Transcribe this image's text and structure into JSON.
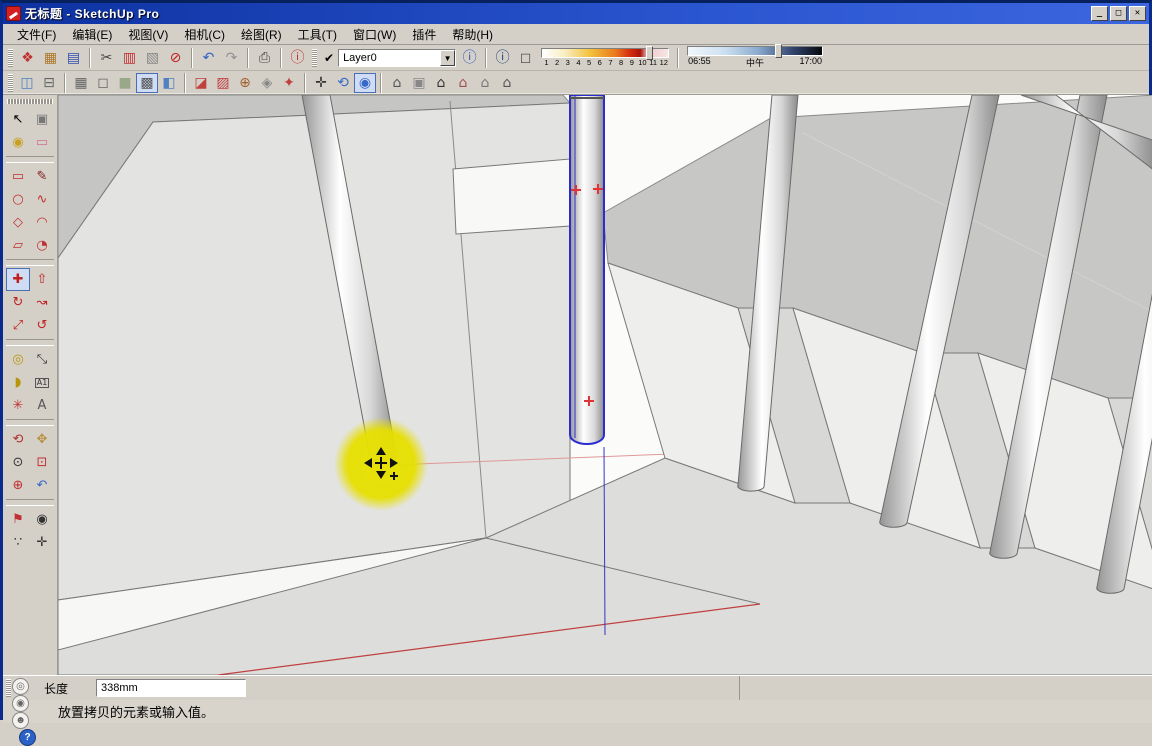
{
  "window": {
    "title": "无标题 - SketchUp Pro",
    "minimize": "_",
    "maximize": "□",
    "close": "✕"
  },
  "menu": {
    "items": [
      "文件(F)",
      "编辑(E)",
      "视图(V)",
      "相机(C)",
      "绘图(R)",
      "工具(T)",
      "窗口(W)",
      "插件",
      "帮助(H)"
    ]
  },
  "toolbar_main": {
    "file_buttons": [
      {
        "name": "new-button",
        "glyph": "❖",
        "color": "#c03030"
      },
      {
        "name": "open-button",
        "glyph": "▦",
        "color": "#b07828"
      },
      {
        "name": "save-button",
        "glyph": "▤",
        "color": "#3050b0"
      }
    ],
    "edit_buttons": [
      {
        "name": "cut-button",
        "glyph": "✂",
        "color": "#444444"
      },
      {
        "name": "copy-button",
        "glyph": "▥",
        "color": "#c03030"
      },
      {
        "name": "paste-button",
        "glyph": "▧",
        "color": "#888888"
      },
      {
        "name": "erase-button",
        "glyph": "⊘",
        "color": "#c02020"
      }
    ],
    "undo_buttons": [
      {
        "name": "undo-button",
        "glyph": "↶",
        "color": "#3060c0"
      },
      {
        "name": "redo-button",
        "glyph": "↷",
        "color": "#909090"
      }
    ],
    "print_buttons": [
      {
        "name": "print-button",
        "glyph": "⎙",
        "color": "#444444"
      }
    ],
    "info_buttons": [
      {
        "name": "model-info-button",
        "glyph": "ⓘ",
        "color": "#c03030"
      }
    ],
    "layer": {
      "check": "✔",
      "selected": "Layer0",
      "dropdown": "▼"
    },
    "layer_buttons": [
      {
        "name": "layer-manager-button",
        "glyph": "ⓘ",
        "color": "#2858b8"
      }
    ],
    "shadow_buttons": [
      {
        "name": "shadow-settings-button",
        "glyph": "ⓘ",
        "color": "#204080"
      },
      {
        "name": "shadow-toggle-button",
        "glyph": "◻",
        "color": "#555555"
      }
    ],
    "month_slider": {
      "ticks": [
        "1",
        "2",
        "3",
        "4",
        "5",
        "6",
        "7",
        "8",
        "9",
        "10",
        "11",
        "12"
      ],
      "value_percent": 84
    },
    "time_slider": {
      "start": "06:55",
      "mid": "中午",
      "end": "17:00",
      "value_percent": 67
    }
  },
  "toolbar_view": {
    "style_buttons_a": [
      {
        "name": "xray-mode-button",
        "glyph": "◫",
        "color": "#5080c0"
      },
      {
        "name": "back-edges-button",
        "glyph": "⊟",
        "color": "#666666"
      }
    ],
    "style_buttons_b": [
      {
        "name": "wireframe-button",
        "glyph": "▦",
        "color": "#666666"
      },
      {
        "name": "hidden-line-button",
        "glyph": "◻",
        "color": "#666666"
      },
      {
        "name": "shaded-button",
        "glyph": "■",
        "color": "#9aa88a"
      },
      {
        "name": "shaded-textures-button",
        "glyph": "▩",
        "color": "#555555",
        "selected": true
      },
      {
        "name": "monochrome-button",
        "glyph": "◧",
        "color": "#5080c0"
      }
    ],
    "section_buttons": [
      {
        "name": "section-plane-button",
        "glyph": "◪",
        "color": "#c04040"
      },
      {
        "name": "section-display-button",
        "glyph": "▨",
        "color": "#c04040"
      }
    ],
    "location_buttons": [
      {
        "name": "add-location-button",
        "glyph": "⊕",
        "color": "#a06030"
      },
      {
        "name": "toggle-terrain-button",
        "glyph": "◈",
        "color": "#888888"
      },
      {
        "name": "photo-textures-button",
        "glyph": "✦",
        "color": "#c04040"
      }
    ],
    "camera_buttons": [
      {
        "name": "position-camera-button",
        "glyph": "✛",
        "color": "#333333"
      },
      {
        "name": "orbit-mode-button",
        "glyph": "⟲",
        "color": "#3868c8"
      },
      {
        "name": "look-around-button",
        "glyph": "◉",
        "color": "#3868c8",
        "selected": true
      }
    ],
    "view_buttons": [
      {
        "name": "iso-view-button",
        "glyph": "⌂",
        "color": "#555555"
      },
      {
        "name": "top-view-button",
        "glyph": "▣",
        "color": "#888888"
      },
      {
        "name": "front-view-button",
        "glyph": "⌂",
        "color": "#333333"
      },
      {
        "name": "right-view-button",
        "glyph": "⌂",
        "color": "#a05050"
      },
      {
        "name": "back-view-button",
        "glyph": "⌂",
        "color": "#777777"
      },
      {
        "name": "left-view-button",
        "glyph": "⌂",
        "color": "#555555"
      }
    ]
  },
  "palette": {
    "tools": [
      {
        "name": "select-tool",
        "glyph": "↖",
        "color": "#000000"
      },
      {
        "name": "make-component-tool",
        "glyph": "▣",
        "color": "#777777"
      },
      {
        "name": "paint-bucket-tool",
        "glyph": "◉",
        "color": "#c8a020"
      },
      {
        "name": "eraser-tool",
        "glyph": "▭",
        "color": "#d07090"
      },
      {
        "sep": true
      },
      {
        "name": "rectangle-tool",
        "glyph": "▭",
        "color": "#c03030"
      },
      {
        "name": "line-tool",
        "glyph": "✎",
        "color": "#802020"
      },
      {
        "name": "circle-tool",
        "glyph": "○",
        "color": "#c03030"
      },
      {
        "name": "freehand-tool",
        "glyph": "∿",
        "color": "#c03030"
      },
      {
        "name": "polygon-tool",
        "glyph": "◇",
        "color": "#c03030"
      },
      {
        "name": "arc-tool",
        "glyph": "◠",
        "color": "#c03030"
      },
      {
        "name": "rotated-rectangle-tool",
        "glyph": "▱",
        "color": "#c03030"
      },
      {
        "name": "pie-tool",
        "glyph": "◔",
        "color": "#c03030"
      },
      {
        "sep": true
      },
      {
        "name": "move-tool",
        "glyph": "✚",
        "color": "#c02020",
        "selected": true
      },
      {
        "name": "push-pull-tool",
        "glyph": "⇧",
        "color": "#c02020"
      },
      {
        "name": "rotate-tool",
        "glyph": "↻",
        "color": "#c02020"
      },
      {
        "name": "follow-me-tool",
        "glyph": "↝",
        "color": "#c02020"
      },
      {
        "name": "scale-tool",
        "glyph": "⤢",
        "color": "#c02020"
      },
      {
        "name": "offset-tool",
        "glyph": "↺",
        "color": "#c02020"
      },
      {
        "sep": true
      },
      {
        "name": "tape-measure-tool",
        "glyph": "◎",
        "color": "#b8960a"
      },
      {
        "name": "dimension-tool",
        "glyph": "⤡",
        "color": "#333333"
      },
      {
        "name": "protractor-tool",
        "glyph": "◗",
        "color": "#b8960a"
      },
      {
        "name": "text-tool",
        "glyph": "A1",
        "color": "#333333",
        "small": true
      },
      {
        "name": "axes-tool",
        "glyph": "✳",
        "color": "#c03030"
      },
      {
        "name": "3d-text-tool",
        "glyph": "A",
        "color": "#555555"
      },
      {
        "sep": true
      },
      {
        "name": "orbit-tool",
        "glyph": "⟲",
        "color": "#b03030"
      },
      {
        "name": "pan-tool",
        "glyph": "✥",
        "color": "#b89040"
      },
      {
        "name": "zoom-tool",
        "glyph": "⊙",
        "color": "#333333"
      },
      {
        "name": "zoom-window-tool",
        "glyph": "⊡",
        "color": "#c03030"
      },
      {
        "name": "zoom-extents-tool",
        "glyph": "⊕",
        "color": "#c03030"
      },
      {
        "name": "previous-view-tool",
        "glyph": "↶",
        "color": "#3868c8"
      },
      {
        "sep": true
      },
      {
        "name": "position-camera-tool",
        "glyph": "⚑",
        "color": "#c03030"
      },
      {
        "name": "look-around-tool",
        "glyph": "◉",
        "color": "#333333"
      },
      {
        "name": "walk-tool",
        "glyph": "∵",
        "color": "#333333"
      },
      {
        "name": "navigation-compass-tool",
        "glyph": "✛",
        "color": "#333333"
      }
    ]
  },
  "measurement_bar": {
    "label": "长度",
    "value": "338mm"
  },
  "status_bar": {
    "icons": [
      {
        "name": "geolocation-button",
        "glyph": "◎"
      },
      {
        "name": "credit-button",
        "glyph": "◉"
      },
      {
        "name": "account-button",
        "glyph": "☻"
      },
      {
        "name": "help-button",
        "glyph": "?",
        "help": true
      }
    ],
    "hint": "放置拷贝的元素或输入值。"
  },
  "colors": {
    "selection_blue": "#2b2bd4",
    "marker_red": "#e03434",
    "highlight_yellow": "#e8e100",
    "edge_red": "#c04040",
    "inference_pink": "#e09898",
    "titlebar_blue": "#0d31a0"
  }
}
